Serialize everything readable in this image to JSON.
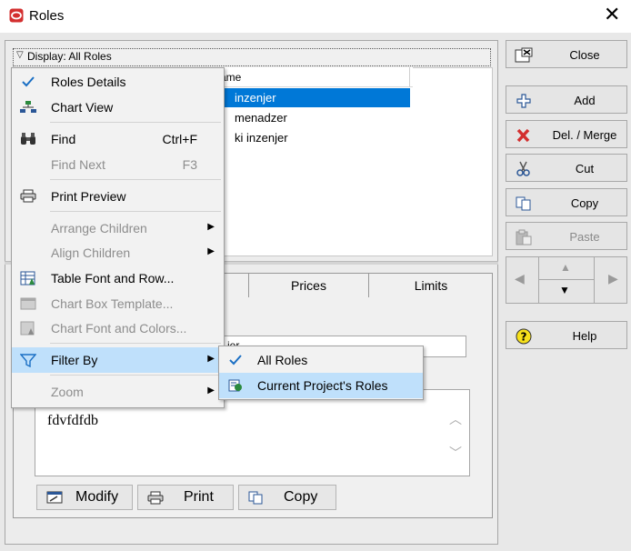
{
  "window": {
    "title": "Roles",
    "close_glyph": "✕"
  },
  "display_bar": {
    "label": "Display: All Roles"
  },
  "list": {
    "header_name": "ame",
    "rows": [
      "inzenjer",
      "menadzer",
      "ki inzenjer"
    ],
    "selected_index": 0
  },
  "tabs": [
    {
      "label": "Prices"
    },
    {
      "label": "Limits"
    }
  ],
  "detail": {
    "name_value": "jer",
    "notes_text": "fdvfdfdb"
  },
  "bottom_buttons": {
    "modify": "Modify",
    "print": "Print",
    "copy": "Copy"
  },
  "side_buttons": {
    "close": "Close",
    "add": "Add",
    "del_merge": "Del. / Merge",
    "cut": "Cut",
    "copy": "Copy",
    "paste": "Paste",
    "help": "Help"
  },
  "context_menu": {
    "roles_details": "Roles Details",
    "chart_view": "Chart View",
    "find": "Find",
    "find_shortcut": "Ctrl+F",
    "find_next": "Find Next",
    "find_next_shortcut": "F3",
    "print_preview": "Print Preview",
    "arrange_children": "Arrange Children",
    "align_children": "Align Children",
    "table_font_row": "Table Font and Row...",
    "chart_box_template": "Chart Box Template...",
    "chart_font_colors": "Chart Font and Colors...",
    "filter_by": "Filter By",
    "zoom": "Zoom"
  },
  "filter_submenu": {
    "all_roles": "All Roles",
    "current_project_roles": "Current Project's Roles",
    "checked": "All Roles"
  },
  "colors": {
    "selection": "#0078d7",
    "menu_highlight": "#bfe0fb",
    "brand_icon": "#d32f2f"
  },
  "icons": {
    "app": "oracle-icon",
    "check": "check-icon",
    "filter": "filter-icon"
  }
}
